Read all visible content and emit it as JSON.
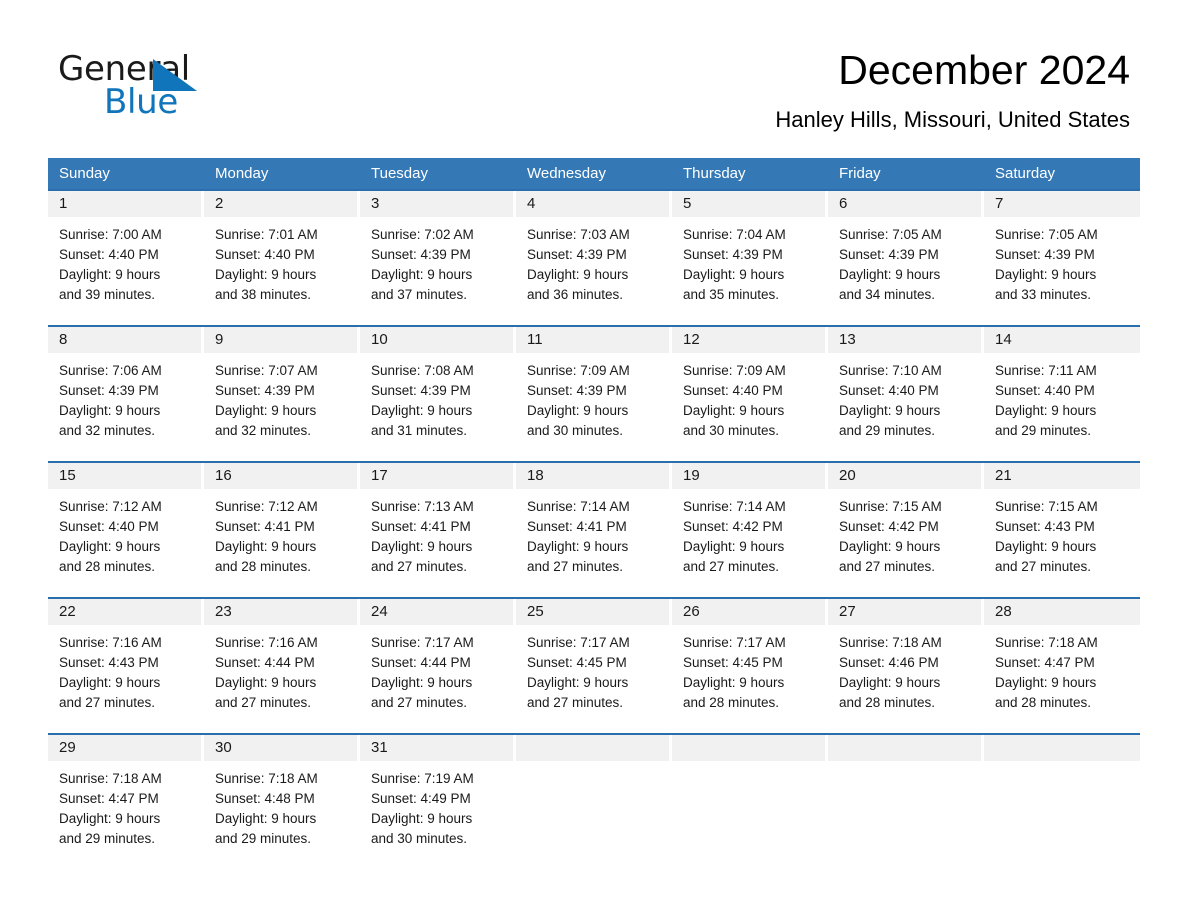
{
  "brand": {
    "name_top": "General",
    "name_bottom": "Blue",
    "accent_color": "#1175bb"
  },
  "header": {
    "title": "December 2024",
    "location": "Hanley Hills, Missouri, United States"
  },
  "theme": {
    "header_blue": "#3479b6",
    "rule_blue": "#2a6eae",
    "daynum_band": "#f1f1f1",
    "text": "#1a1a1a"
  },
  "weekdays": [
    "Sunday",
    "Monday",
    "Tuesday",
    "Wednesday",
    "Thursday",
    "Friday",
    "Saturday"
  ],
  "weeks": [
    [
      {
        "day": "1",
        "sunrise": "Sunrise: 7:00 AM",
        "sunset": "Sunset: 4:40 PM",
        "daylight_1": "Daylight: 9 hours",
        "daylight_2": "and 39 minutes."
      },
      {
        "day": "2",
        "sunrise": "Sunrise: 7:01 AM",
        "sunset": "Sunset: 4:40 PM",
        "daylight_1": "Daylight: 9 hours",
        "daylight_2": "and 38 minutes."
      },
      {
        "day": "3",
        "sunrise": "Sunrise: 7:02 AM",
        "sunset": "Sunset: 4:39 PM",
        "daylight_1": "Daylight: 9 hours",
        "daylight_2": "and 37 minutes."
      },
      {
        "day": "4",
        "sunrise": "Sunrise: 7:03 AM",
        "sunset": "Sunset: 4:39 PM",
        "daylight_1": "Daylight: 9 hours",
        "daylight_2": "and 36 minutes."
      },
      {
        "day": "5",
        "sunrise": "Sunrise: 7:04 AM",
        "sunset": "Sunset: 4:39 PM",
        "daylight_1": "Daylight: 9 hours",
        "daylight_2": "and 35 minutes."
      },
      {
        "day": "6",
        "sunrise": "Sunrise: 7:05 AM",
        "sunset": "Sunset: 4:39 PM",
        "daylight_1": "Daylight: 9 hours",
        "daylight_2": "and 34 minutes."
      },
      {
        "day": "7",
        "sunrise": "Sunrise: 7:05 AM",
        "sunset": "Sunset: 4:39 PM",
        "daylight_1": "Daylight: 9 hours",
        "daylight_2": "and 33 minutes."
      }
    ],
    [
      {
        "day": "8",
        "sunrise": "Sunrise: 7:06 AM",
        "sunset": "Sunset: 4:39 PM",
        "daylight_1": "Daylight: 9 hours",
        "daylight_2": "and 32 minutes."
      },
      {
        "day": "9",
        "sunrise": "Sunrise: 7:07 AM",
        "sunset": "Sunset: 4:39 PM",
        "daylight_1": "Daylight: 9 hours",
        "daylight_2": "and 32 minutes."
      },
      {
        "day": "10",
        "sunrise": "Sunrise: 7:08 AM",
        "sunset": "Sunset: 4:39 PM",
        "daylight_1": "Daylight: 9 hours",
        "daylight_2": "and 31 minutes."
      },
      {
        "day": "11",
        "sunrise": "Sunrise: 7:09 AM",
        "sunset": "Sunset: 4:39 PM",
        "daylight_1": "Daylight: 9 hours",
        "daylight_2": "and 30 minutes."
      },
      {
        "day": "12",
        "sunrise": "Sunrise: 7:09 AM",
        "sunset": "Sunset: 4:40 PM",
        "daylight_1": "Daylight: 9 hours",
        "daylight_2": "and 30 minutes."
      },
      {
        "day": "13",
        "sunrise": "Sunrise: 7:10 AM",
        "sunset": "Sunset: 4:40 PM",
        "daylight_1": "Daylight: 9 hours",
        "daylight_2": "and 29 minutes."
      },
      {
        "day": "14",
        "sunrise": "Sunrise: 7:11 AM",
        "sunset": "Sunset: 4:40 PM",
        "daylight_1": "Daylight: 9 hours",
        "daylight_2": "and 29 minutes."
      }
    ],
    [
      {
        "day": "15",
        "sunrise": "Sunrise: 7:12 AM",
        "sunset": "Sunset: 4:40 PM",
        "daylight_1": "Daylight: 9 hours",
        "daylight_2": "and 28 minutes."
      },
      {
        "day": "16",
        "sunrise": "Sunrise: 7:12 AM",
        "sunset": "Sunset: 4:41 PM",
        "daylight_1": "Daylight: 9 hours",
        "daylight_2": "and 28 minutes."
      },
      {
        "day": "17",
        "sunrise": "Sunrise: 7:13 AM",
        "sunset": "Sunset: 4:41 PM",
        "daylight_1": "Daylight: 9 hours",
        "daylight_2": "and 27 minutes."
      },
      {
        "day": "18",
        "sunrise": "Sunrise: 7:14 AM",
        "sunset": "Sunset: 4:41 PM",
        "daylight_1": "Daylight: 9 hours",
        "daylight_2": "and 27 minutes."
      },
      {
        "day": "19",
        "sunrise": "Sunrise: 7:14 AM",
        "sunset": "Sunset: 4:42 PM",
        "daylight_1": "Daylight: 9 hours",
        "daylight_2": "and 27 minutes."
      },
      {
        "day": "20",
        "sunrise": "Sunrise: 7:15 AM",
        "sunset": "Sunset: 4:42 PM",
        "daylight_1": "Daylight: 9 hours",
        "daylight_2": "and 27 minutes."
      },
      {
        "day": "21",
        "sunrise": "Sunrise: 7:15 AM",
        "sunset": "Sunset: 4:43 PM",
        "daylight_1": "Daylight: 9 hours",
        "daylight_2": "and 27 minutes."
      }
    ],
    [
      {
        "day": "22",
        "sunrise": "Sunrise: 7:16 AM",
        "sunset": "Sunset: 4:43 PM",
        "daylight_1": "Daylight: 9 hours",
        "daylight_2": "and 27 minutes."
      },
      {
        "day": "23",
        "sunrise": "Sunrise: 7:16 AM",
        "sunset": "Sunset: 4:44 PM",
        "daylight_1": "Daylight: 9 hours",
        "daylight_2": "and 27 minutes."
      },
      {
        "day": "24",
        "sunrise": "Sunrise: 7:17 AM",
        "sunset": "Sunset: 4:44 PM",
        "daylight_1": "Daylight: 9 hours",
        "daylight_2": "and 27 minutes."
      },
      {
        "day": "25",
        "sunrise": "Sunrise: 7:17 AM",
        "sunset": "Sunset: 4:45 PM",
        "daylight_1": "Daylight: 9 hours",
        "daylight_2": "and 27 minutes."
      },
      {
        "day": "26",
        "sunrise": "Sunrise: 7:17 AM",
        "sunset": "Sunset: 4:45 PM",
        "daylight_1": "Daylight: 9 hours",
        "daylight_2": "and 28 minutes."
      },
      {
        "day": "27",
        "sunrise": "Sunrise: 7:18 AM",
        "sunset": "Sunset: 4:46 PM",
        "daylight_1": "Daylight: 9 hours",
        "daylight_2": "and 28 minutes."
      },
      {
        "day": "28",
        "sunrise": "Sunrise: 7:18 AM",
        "sunset": "Sunset: 4:47 PM",
        "daylight_1": "Daylight: 9 hours",
        "daylight_2": "and 28 minutes."
      }
    ],
    [
      {
        "day": "29",
        "sunrise": "Sunrise: 7:18 AM",
        "sunset": "Sunset: 4:47 PM",
        "daylight_1": "Daylight: 9 hours",
        "daylight_2": "and 29 minutes."
      },
      {
        "day": "30",
        "sunrise": "Sunrise: 7:18 AM",
        "sunset": "Sunset: 4:48 PM",
        "daylight_1": "Daylight: 9 hours",
        "daylight_2": "and 29 minutes."
      },
      {
        "day": "31",
        "sunrise": "Sunrise: 7:19 AM",
        "sunset": "Sunset: 4:49 PM",
        "daylight_1": "Daylight: 9 hours",
        "daylight_2": "and 30 minutes."
      },
      {
        "day": "",
        "sunrise": "",
        "sunset": "",
        "daylight_1": "",
        "daylight_2": ""
      },
      {
        "day": "",
        "sunrise": "",
        "sunset": "",
        "daylight_1": "",
        "daylight_2": ""
      },
      {
        "day": "",
        "sunrise": "",
        "sunset": "",
        "daylight_1": "",
        "daylight_2": ""
      },
      {
        "day": "",
        "sunrise": "",
        "sunset": "",
        "daylight_1": "",
        "daylight_2": ""
      }
    ]
  ]
}
